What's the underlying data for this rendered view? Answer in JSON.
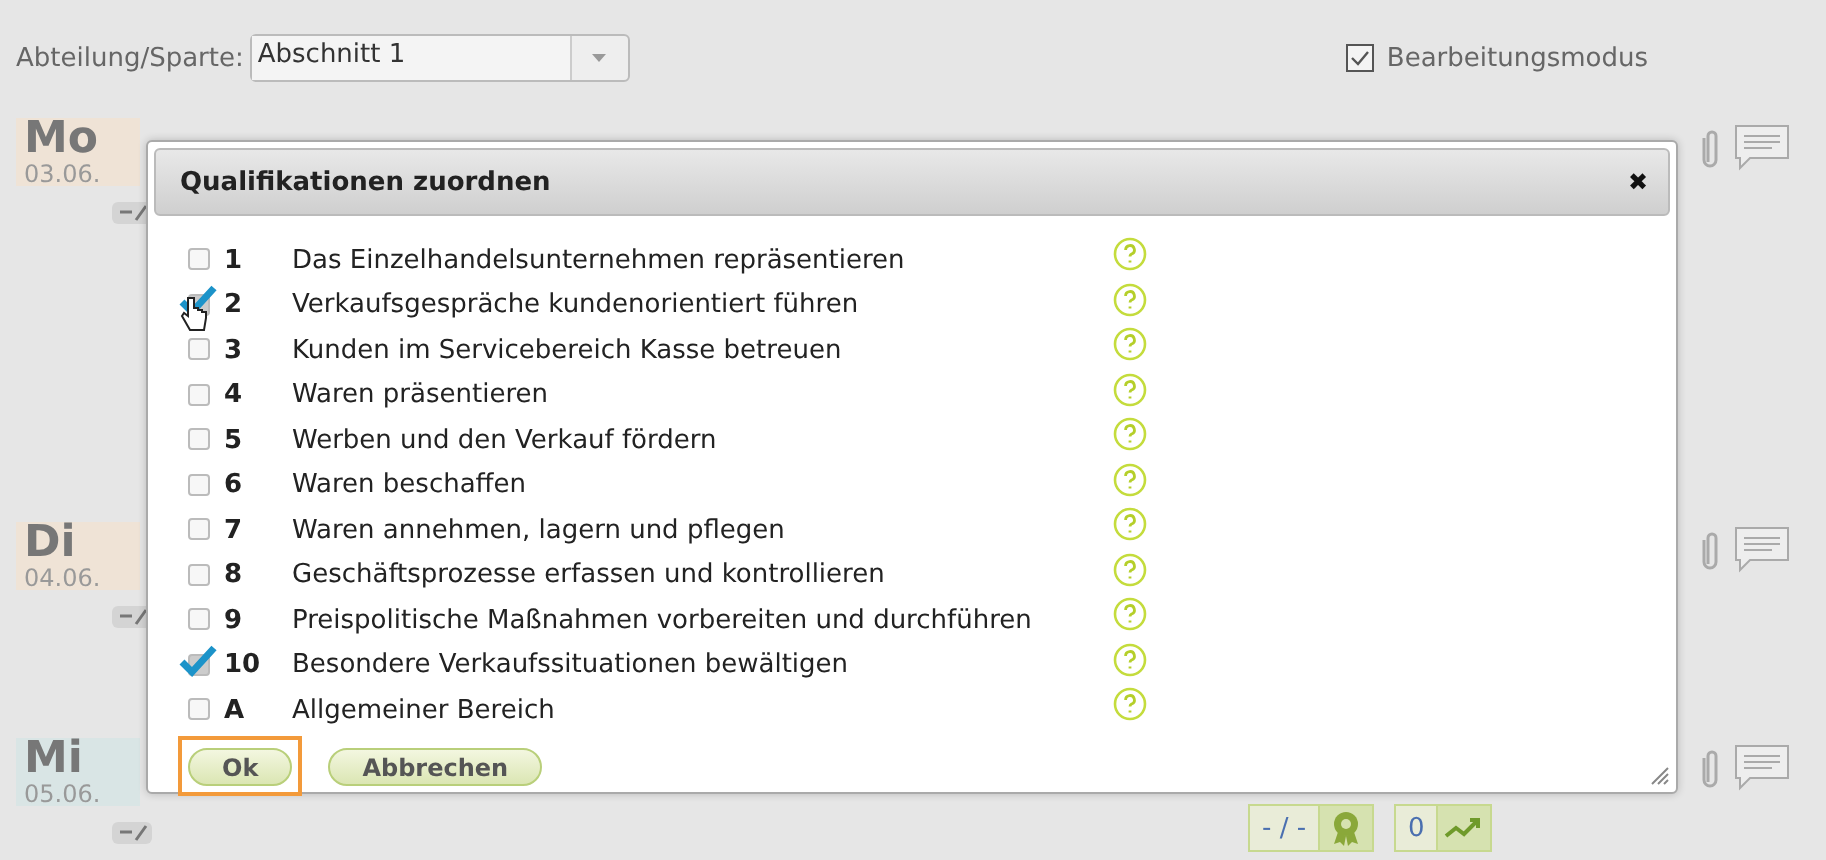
{
  "header": {
    "department_label": "Abteilung/Sparte:",
    "department_value": "Abschnitt 1",
    "edit_mode": {
      "label": "Bearbeitungsmodus",
      "checked": true
    }
  },
  "days": [
    {
      "day": "Mo",
      "date": "03.06.",
      "color": "#efe3d6"
    },
    {
      "day": "Di",
      "date": "04.06.",
      "color": "#efe3d6"
    },
    {
      "day": "Mi",
      "date": "05.06.",
      "color": "#d9e5e5"
    }
  ],
  "dialog": {
    "title": "Qualifikationen zuordnen",
    "close": "✖",
    "items": [
      {
        "number": "1",
        "label": "Das Einzelhandelsunternehmen repräsentieren",
        "checked": false
      },
      {
        "number": "2",
        "label": "Verkaufsgespräche kundenorientiert führen",
        "checked": true
      },
      {
        "number": "3",
        "label": "Kunden im Servicebereich Kasse betreuen",
        "checked": false
      },
      {
        "number": "4",
        "label": "Waren präsentieren",
        "checked": false
      },
      {
        "number": "5",
        "label": "Werben und den Verkauf fördern",
        "checked": false
      },
      {
        "number": "6",
        "label": "Waren beschaffen",
        "checked": false
      },
      {
        "number": "7",
        "label": "Waren annehmen, lagern und pflegen",
        "checked": false
      },
      {
        "number": "8",
        "label": "Geschäftsprozesse erfassen und kontrollieren",
        "checked": false
      },
      {
        "number": "9",
        "label": "Preispolitische Maßnahmen vorbereiten und durchführen",
        "checked": false
      },
      {
        "number": "10",
        "label": "Besondere Verkaufssituationen bewältigen",
        "checked": true
      },
      {
        "number": "A",
        "label": "Allgemeiner Bereich",
        "checked": false
      }
    ],
    "buttons": [
      {
        "label": "Ok",
        "focused": true
      },
      {
        "label": "Abbrechen",
        "focused": false
      }
    ]
  },
  "footer": {
    "grade": "- / -",
    "count": "0"
  }
}
